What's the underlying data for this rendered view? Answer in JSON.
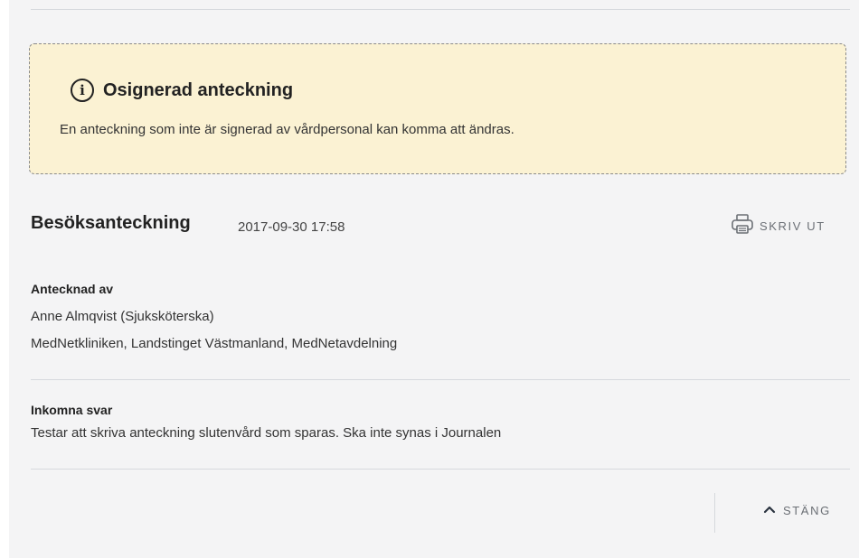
{
  "alert": {
    "icon": "info-icon",
    "title": "Osignerad anteckning",
    "text": "En anteckning som inte är signerad av vårdpersonal kan komma att ändras."
  },
  "note": {
    "title": "Besöksanteckning",
    "datetime": "2017-09-30 17:58",
    "print_label": "SKRIV UT",
    "print_icon": "printer-icon",
    "author_label": "Antecknad av",
    "author_name": "Anne Almqvist (Sjuksköterska)",
    "author_unit": "MedNetkliniken, Landstinget Västmanland, MedNetavdelning",
    "replies_label": "Inkomna svar",
    "replies_text": "Testar att skriva anteckning slutenvård som sparas. Ska inte synas i Journalen"
  },
  "footer": {
    "close_label": "STÄNG",
    "close_icon": "chevron-up-icon"
  },
  "colors": {
    "panel_bg": "#f4f4f5",
    "alert_bg": "#fbf2d3",
    "muted_text": "#6b6f75"
  }
}
